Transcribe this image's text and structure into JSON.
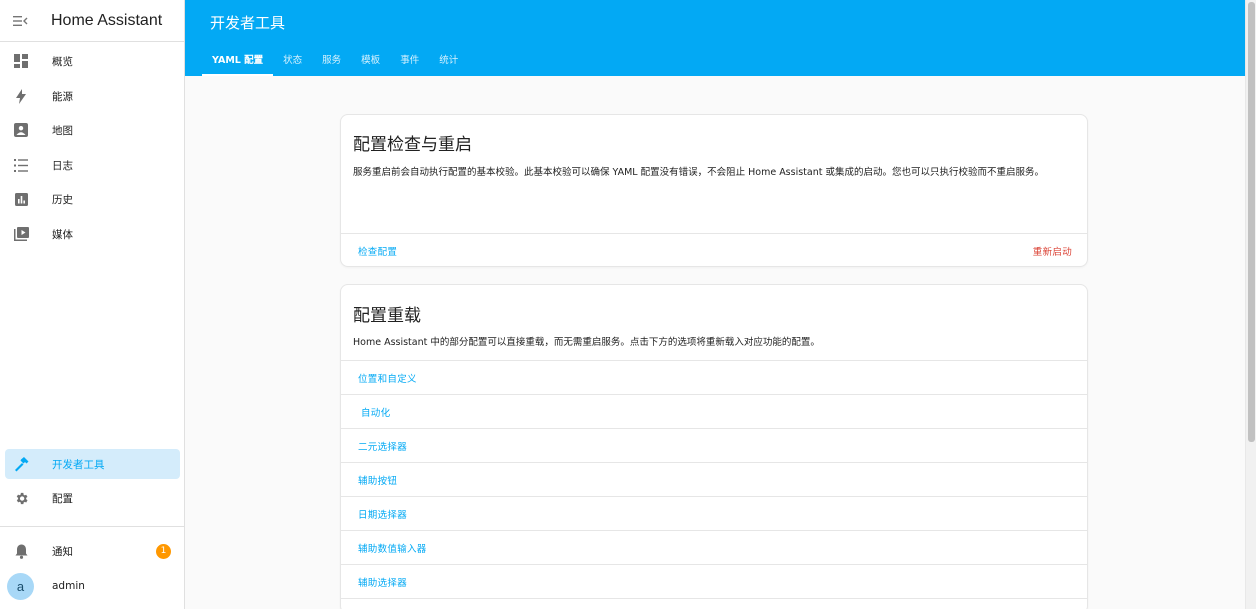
{
  "app": {
    "title": "Home Assistant"
  },
  "sidebar": {
    "items": [
      {
        "label": "概览",
        "icon": "dashboard-icon"
      },
      {
        "label": "能源",
        "icon": "lightning-icon"
      },
      {
        "label": "地图",
        "icon": "map-icon"
      },
      {
        "label": "日志",
        "icon": "logbook-icon"
      },
      {
        "label": "历史",
        "icon": "history-chart-icon"
      },
      {
        "label": "媒体",
        "icon": "media-icon"
      }
    ],
    "developer_tools": {
      "label": "开发者工具",
      "icon": "hammer-icon"
    },
    "settings": {
      "label": "配置",
      "icon": "gear-icon"
    },
    "notifications": {
      "label": "通知",
      "icon": "bell-icon",
      "count": "1"
    },
    "user": {
      "name": "admin",
      "avatar_letter": "a"
    }
  },
  "header": {
    "title": "开发者工具",
    "tabs": [
      {
        "label": "YAML 配置",
        "active": true
      },
      {
        "label": "状态"
      },
      {
        "label": "服务"
      },
      {
        "label": "模板"
      },
      {
        "label": "事件"
      },
      {
        "label": "统计"
      }
    ]
  },
  "check_card": {
    "title": "配置检查与重启",
    "description": "服务重启前会自动执行配置的基本校验。此基本校验可以确保 YAML 配置没有错误，不会阻止 Home Assistant 或集成的启动。您也可以只执行校验而不重启服务。",
    "check_button": "检查配置",
    "restart_button": "重新启动"
  },
  "reload_card": {
    "title": "配置重载",
    "description": "Home Assistant 中的部分配置可以直接重载，而无需重启服务。点击下方的选项将重新载入对应功能的配置。",
    "items": [
      "位置和自定义",
      "自动化",
      "二元选择器",
      "辅助按钮",
      "日期选择器",
      "辅助数值输入器",
      "辅助选择器"
    ]
  },
  "colors": {
    "primary": "#03a9f4",
    "danger": "#db4437",
    "badge": "#ff9800"
  }
}
